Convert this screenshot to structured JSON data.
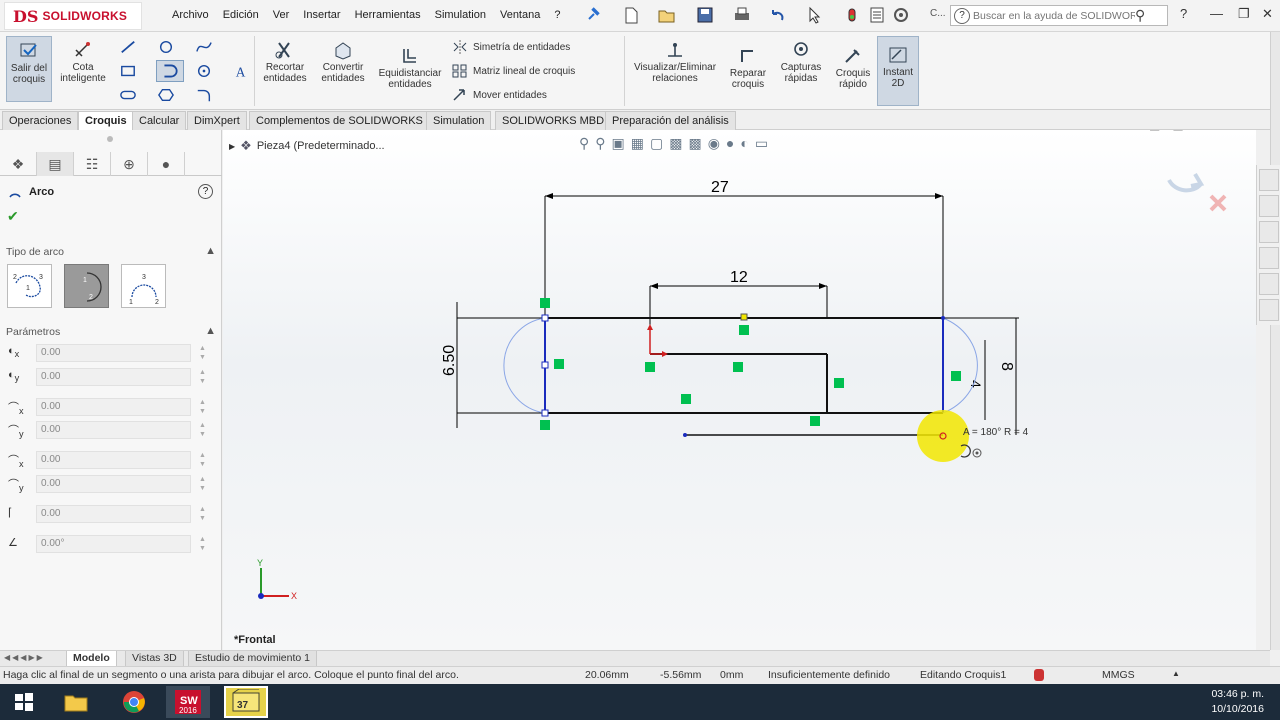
{
  "app": {
    "logo": {
      "mark": "DS",
      "name": "SOLIDWORKS"
    },
    "menu": [
      "Archivo",
      "Edición",
      "Ver",
      "Insertar",
      "Herramientas",
      "Simulation",
      "Ventana",
      "?"
    ],
    "toolbar_ellipsis": "C...",
    "help_search_placeholder": "Buscar en la ayuda de SOLIDWORKS",
    "help_icon": "?"
  },
  "ribbon": {
    "exit_sketch": "Salir del croquis",
    "smart_dim": "Cota inteligente",
    "trim": "Recortar entidades",
    "convert": "Convertir entidades",
    "offset": "Equidistanciar entidades",
    "mirror": "Simetría de entidades",
    "linear_pattern": "Matriz lineal de croquis",
    "move": "Mover entidades",
    "relations": "Visualizar/Eliminar relaciones",
    "repair": "Reparar croquis",
    "quick_snaps": "Capturas rápidas",
    "rapid_sketch": "Croquis rápido",
    "instant2d": "Instant 2D"
  },
  "tabs": [
    "Operaciones",
    "Croquis",
    "Calcular",
    "DimXpert",
    "Complementos de SOLIDWORKS",
    "Simulation",
    "SOLIDWORKS MBD",
    "Preparación del análisis"
  ],
  "active_tab": "Croquis",
  "property_manager": {
    "title": "Arco",
    "arc_type_header": "Tipo de arco",
    "params_header": "Parámetros",
    "params": [
      "0.00",
      "0.00",
      "0.00",
      "0.00",
      "0.00",
      "0.00",
      "0.00",
      "0.00°"
    ]
  },
  "graphics": {
    "tree_item": "Pieza4  (Predeterminado...",
    "view_label": "*Frontal",
    "dim_27": "27",
    "dim_12": "12",
    "dim_650": "6.50",
    "dim_8": "8",
    "dim_4": "4",
    "cursor_feedback": "A = 180°  R = 4",
    "triad_x": "X",
    "triad_y": "Y"
  },
  "bottom_tabs": [
    "Modelo",
    "Vistas 3D",
    "Estudio de movimiento 1"
  ],
  "status": {
    "message": "Haga clic al final de un segmento o una arista para dibujar el arco. Coloque el punto final del arco.",
    "x": "20.06mm",
    "y": "-5.56mm",
    "z": "0mm",
    "definition": "Insuficientemente definido",
    "mode": "Editando Croquis1",
    "units": "MMGS"
  },
  "taskbar": {
    "time": "03:46 p. m.",
    "date": "10/10/2016",
    "sw_label": "2016"
  },
  "colors": {
    "accent_red": "#c8102e",
    "sketch_blue": "#1a2bbd",
    "relation_green": "#00c050",
    "cursor_yellow": "#f2e600"
  }
}
